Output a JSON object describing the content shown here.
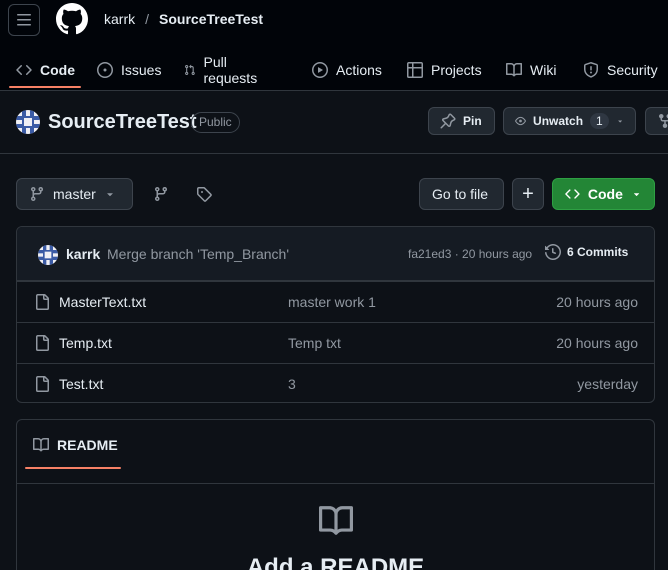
{
  "header": {
    "owner": "karrk",
    "separator": "/",
    "repo": "SourceTreeTest"
  },
  "tabs": [
    {
      "label": "Code",
      "icon": "code-icon",
      "active": true
    },
    {
      "label": "Issues",
      "icon": "issue-icon"
    },
    {
      "label": "Pull requests",
      "icon": "pull-request-icon"
    },
    {
      "label": "Actions",
      "icon": "play-icon"
    },
    {
      "label": "Projects",
      "icon": "table-icon"
    },
    {
      "label": "Wiki",
      "icon": "book-icon"
    },
    {
      "label": "Security",
      "icon": "shield-icon"
    }
  ],
  "repo": {
    "title": "SourceTreeTest",
    "visibility": "Public",
    "pin_label": "Pin",
    "watch_label": "Unwatch",
    "watch_count": "1"
  },
  "branch_bar": {
    "branch": "master",
    "go_to_file": "Go to file",
    "add_icon": "+",
    "code_label": "Code"
  },
  "commit": {
    "author": "karrk",
    "message": "Merge branch 'Temp_Branch'",
    "meta": "fa21ed3 · 20 hours ago",
    "commits_label": "6 Commits"
  },
  "files": [
    {
      "name": "MasterText.txt",
      "message": "master work 1",
      "date": "20 hours ago"
    },
    {
      "name": "Temp.txt",
      "message": "Temp txt",
      "date": "20 hours ago"
    },
    {
      "name": "Test.txt",
      "message": "3",
      "date": "yesterday"
    }
  ],
  "readme": {
    "tab_label": "README",
    "heading": "Add a README"
  },
  "colors": {
    "background": "#0d1117",
    "accent_underline": "#f78166",
    "code_button": "#238636"
  }
}
